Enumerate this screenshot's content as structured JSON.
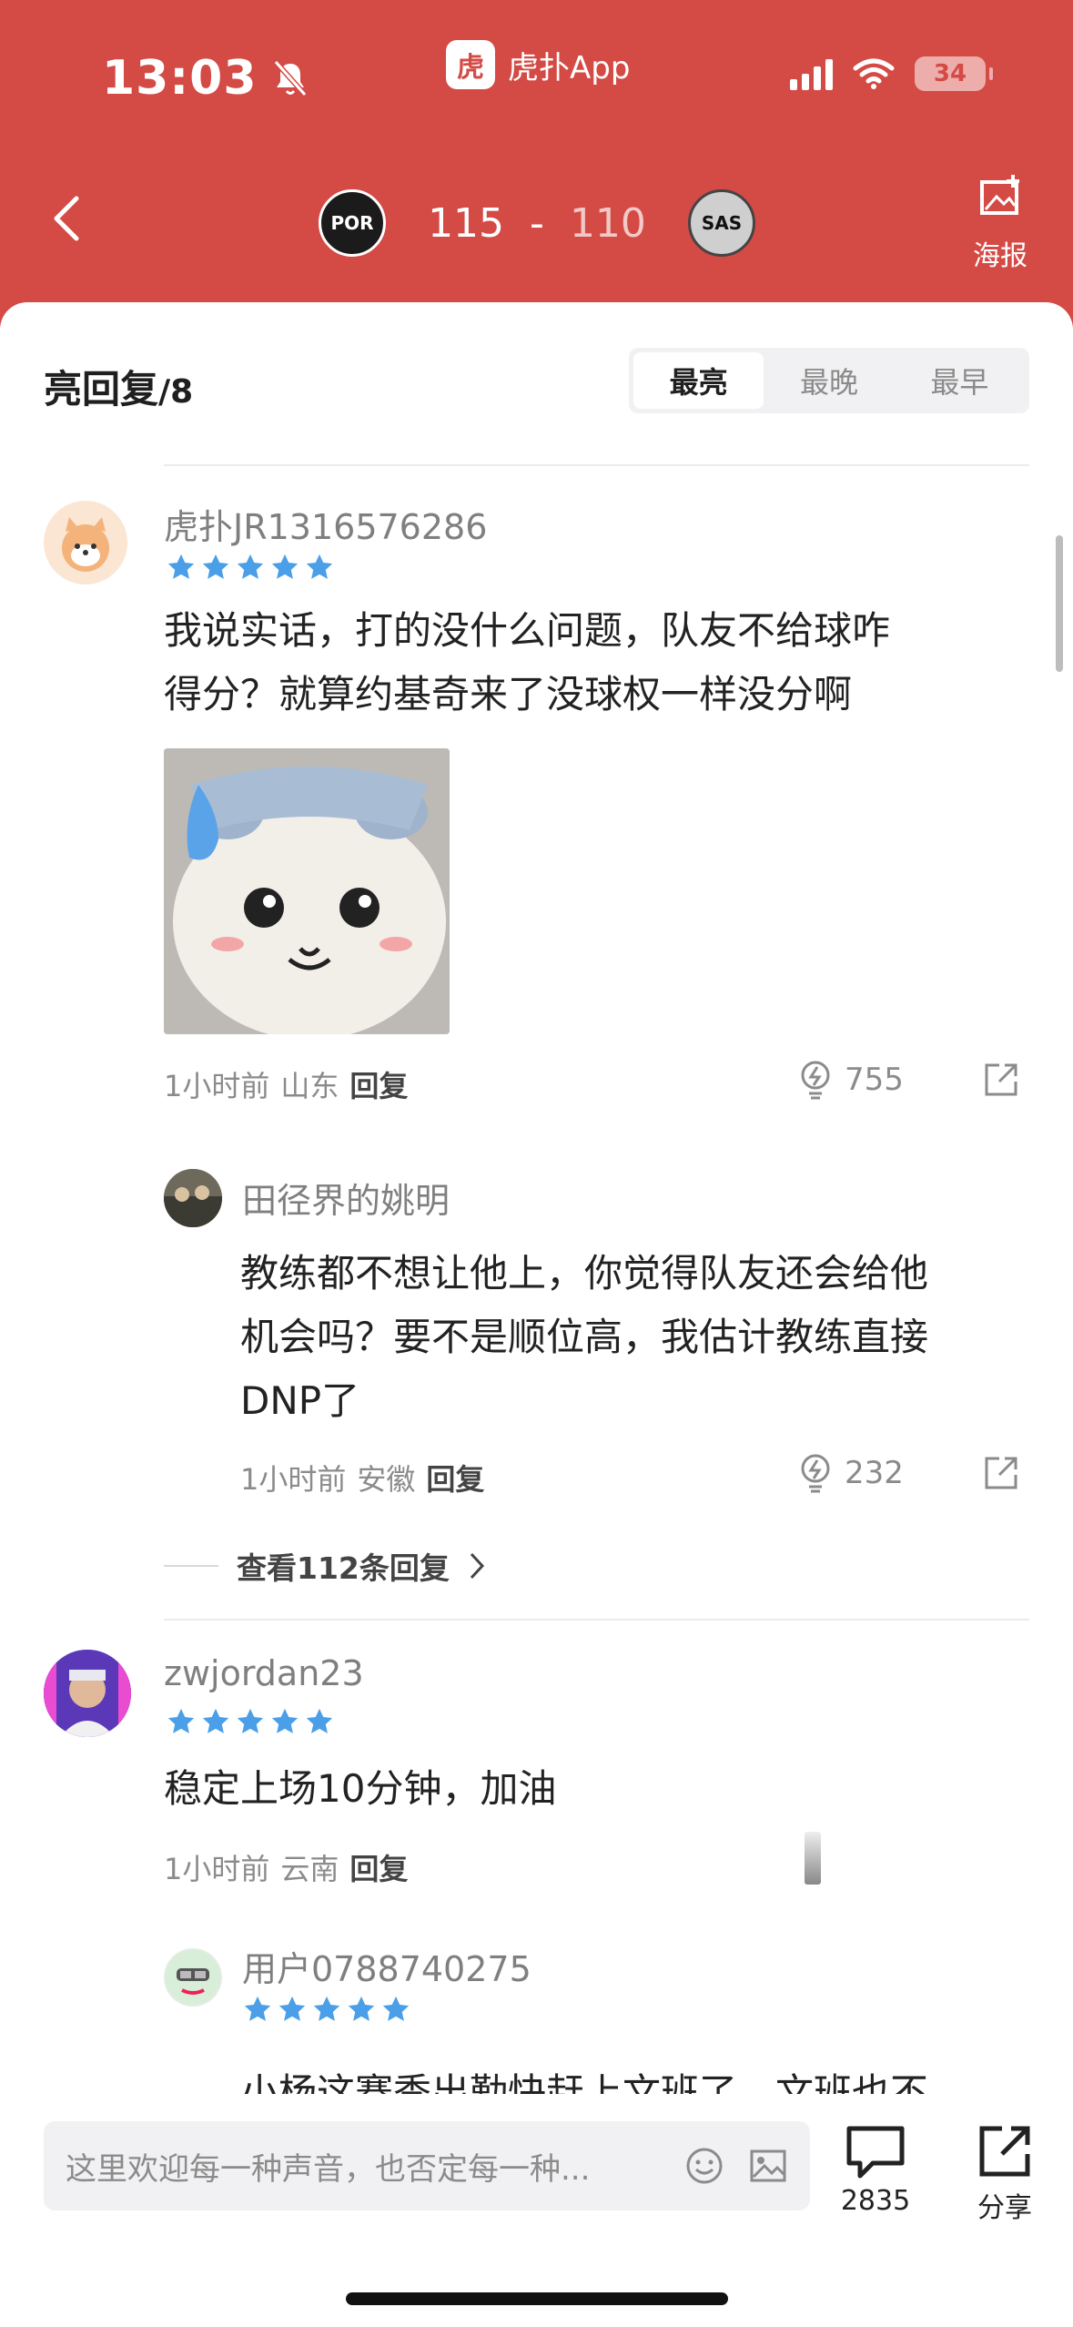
{
  "status": {
    "time": "13:03",
    "battery": "34"
  },
  "app": {
    "logo_char": "虎",
    "name": "虎扑App"
  },
  "game": {
    "home_score": "115",
    "separator": "-",
    "away_score": "110",
    "home_team": "POR",
    "away_team": "SAS"
  },
  "poster_label": "海报",
  "section": {
    "title": "亮回复",
    "count": "/8"
  },
  "sort_tabs": [
    "最亮",
    "最晚",
    "最早"
  ],
  "comments": [
    {
      "username": "虎扑JR1316576286",
      "text_lines": [
        "我说实话，打的没什么问题，队友不给球咋",
        "得分？就算约基奇来了没球权一样没分啊"
      ],
      "time": "1小时前",
      "location": "山东",
      "reply_label": "回复",
      "likes": "755"
    },
    {
      "username": "田径界的姚明",
      "text_lines": [
        "教练都不想让他上，你觉得队友还会给他",
        "机会吗？要不是顺位高，我估计教练直接",
        "DNP了"
      ],
      "time": "1小时前",
      "location": "安徽",
      "reply_label": "回复",
      "likes": "232"
    },
    {
      "username": "zwjordan23",
      "text_lines": [
        "稳定上场10分钟，加油"
      ],
      "time": "1小时前",
      "location": "云南",
      "reply_label": "回复"
    },
    {
      "username": "用户0788740275",
      "text_lines": [
        "小杨这赛季出勤快赶上文班了，文班也不"
      ]
    }
  ],
  "view_replies": "查看112条回复",
  "input": {
    "placeholder": "这里欢迎每一种声音，也否定每一种..."
  },
  "actions": {
    "comment_count": "2835",
    "share_label": "分享"
  },
  "colors": {
    "brand": "#d44a45",
    "star": "#4a9fe8"
  }
}
